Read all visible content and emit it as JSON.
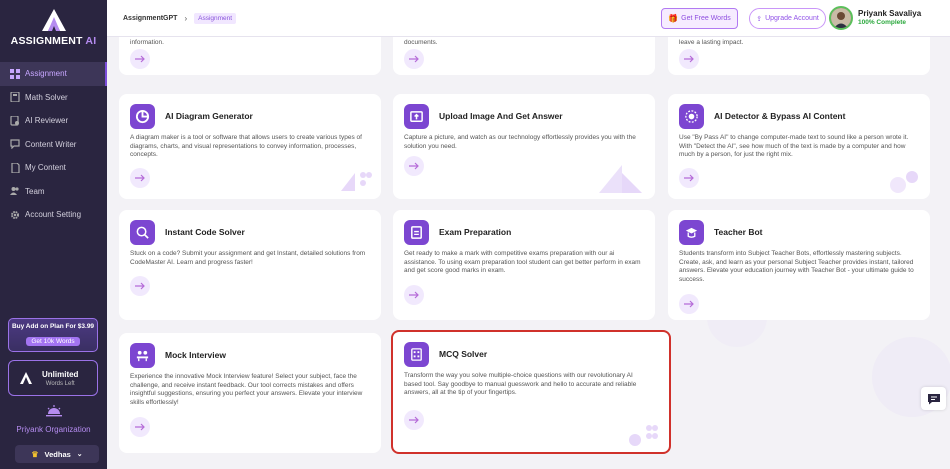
{
  "app": {
    "name_main": "ASSIGNMENT",
    "name_ai": "AI"
  },
  "sidebar": {
    "items": [
      {
        "label": "Assignment",
        "icon": "grid-icon",
        "active": true
      },
      {
        "label": "Math Solver",
        "icon": "calculator-icon",
        "active": false
      },
      {
        "label": "AI Reviewer",
        "icon": "reviewer-icon",
        "active": false
      },
      {
        "label": "Content Writer",
        "icon": "chat-icon",
        "active": false
      },
      {
        "label": "My Content",
        "icon": "document-icon",
        "active": false
      },
      {
        "label": "Team",
        "icon": "team-icon",
        "active": false
      },
      {
        "label": "Account Setting",
        "icon": "gear-icon",
        "active": false
      }
    ],
    "addon": {
      "title": "Buy Add on Plan For $3.99",
      "button": "Get 10k Words"
    },
    "plan": {
      "title": "Unlimited",
      "subtitle": "Words Left"
    },
    "organization": "Priyank Organization",
    "workspace": "Vedhas"
  },
  "header": {
    "breadcrumb": [
      "AssignmentGPT",
      "Assignment"
    ],
    "free_words": "Get Free Words",
    "upgrade": "Upgrade Account",
    "user_name": "Priyank Savaliya",
    "user_status": "100% Complete"
  },
  "top_fragments": [
    "information.",
    "documents.",
    "leave a lasting impact."
  ],
  "cards": [
    {
      "title": "AI Diagram Generator",
      "icon": "pie-chart-icon",
      "desc": "A diagram maker is a tool or software that allows users to create various types of diagrams, charts, and visual representations to convey information, processes, concepts."
    },
    {
      "title": "Upload Image And Get Answer",
      "icon": "image-upload-icon",
      "desc": "Capture a picture, and watch as our technology effortlessly provides you with the solution you need."
    },
    {
      "title": "AI Detector & Bypass AI Content",
      "icon": "detector-icon",
      "desc": "Use \"By Pass AI\" to change computer-made text to sound like a person wrote it. With \"Detect the AI\", see how much of the text is made by a computer and how much by a person, for just the right mix."
    },
    {
      "title": "Instant Code Solver",
      "icon": "code-search-icon",
      "desc": "Stuck on a code? Submit your assignment and get Instant, detailed solutions from CodeMaster AI. Learn and progress faster!"
    },
    {
      "title": "Exam Preparation",
      "icon": "clipboard-icon",
      "desc": "Get ready to make a mark with competitive exams preparation with our ai assistance. To using exam preparation tool student can get better perform in exam and get score good marks in exam."
    },
    {
      "title": "Teacher Bot",
      "icon": "teacher-icon",
      "desc": "Students transform into Subject Teacher Bots, effortlessly mastering subjects. Create, ask, and learn as your personal Subject Teacher provides instant, tailored answers. Elevate your education journey with Teacher Bot - your ultimate guide to success."
    },
    {
      "title": "Mock Interview",
      "icon": "interview-icon",
      "desc": "Experience the innovative Mock Interview feature! Select your subject, face the challenge, and receive instant feedback. Our tool corrects mistakes and offers insightful suggestions, ensuring you perfect your answers. Elevate your interview skills effortlessly!"
    },
    {
      "title": "MCQ Solver",
      "icon": "mcq-icon",
      "desc": "Transform the way you solve multiple-choice questions with our revolutionary AI based tool. Say goodbye to manual guesswork and hello to accurate and reliable answers, all at the tip of your fingertips."
    }
  ],
  "colors": {
    "sidebar_bg": "#2a2540",
    "accent": "#7c46d1",
    "highlight": "#d0312b"
  }
}
